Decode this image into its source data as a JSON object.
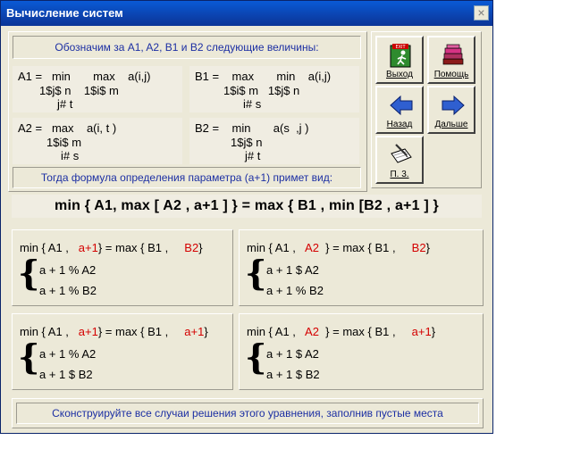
{
  "window": {
    "title": "Вычисление систем",
    "close_glyph": "×"
  },
  "intro": "Обозначим за A1, A2, B1 и B2 следующие величины:",
  "definitions": {
    "a1": {
      "l1": "A1 =   min       max    a(i,j)",
      "l2": "1$j$ n    1$i$ m",
      "l3": "j# t"
    },
    "b1": {
      "l1": "B1 =    max       min    a(i,j)",
      "l2": "1$i$ m   1$j$ n",
      "l3": "i# s"
    },
    "a2": {
      "l1": "A2 =   max    a(i, t )",
      "l2": "1$i$ m",
      "l3": "i# s"
    },
    "b2": {
      "l1": "B2 =    min       a(s  ,j )",
      "l2": "1$j$ n",
      "l3": "j# t"
    }
  },
  "formula_caption": "Тогда формула определения параметра (a+1) примет вид:",
  "main_formula": "min { A1, max [ A2 , a+1 ] } = max { B1 , min [B2 , a+1 ] }",
  "cases": [
    {
      "pre": "min { A1 ,   ",
      "v1": "a+1",
      "mid": "} = max { B1 ,     ",
      "v2": "B2",
      "end": "}",
      "r1": "a + 1 % A2",
      "r2": "a + 1 % B2"
    },
    {
      "pre": "min { A1 ,   ",
      "v1": "A2",
      "mid": "  } = max { B1 ,     ",
      "v2": "B2",
      "end": "}",
      "r1": "a + 1 $ A2",
      "r2": "a + 1 % B2"
    },
    {
      "pre": "min { A1 ,   ",
      "v1": "a+1",
      "mid": "} = max { B1 ,     ",
      "v2": "a+1",
      "end": "}",
      "r1": "a + 1 % A2",
      "r2": "a + 1 $ B2"
    },
    {
      "pre": "min { A1 ,   ",
      "v1": "A2",
      "mid": "  } = max { B1 ,     ",
      "v2": "a+1",
      "end": "}",
      "r1": "a + 1 $ A2",
      "r2": "a + 1 $ B2"
    }
  ],
  "footer": "Сконструируйте все случаи решения этого уравнения, заполнив пустые места",
  "toolbar": {
    "exit_label": "Выход",
    "exit_sign": "EXIT",
    "help_label": "Помощь",
    "back_label": "Назад",
    "next_label": "Дальше",
    "p3_label": "П. 3.",
    "exit_icon": "exit-door-icon",
    "help_icon": "books-icon",
    "back_icon": "arrow-left-icon",
    "next_icon": "arrow-right-icon",
    "p3_icon": "notepad-pencil-icon"
  },
  "colors": {
    "caption": "#1c2fa3",
    "blank": "#d40000",
    "titlebar": "#0a3597",
    "face": "#ece9d8"
  }
}
